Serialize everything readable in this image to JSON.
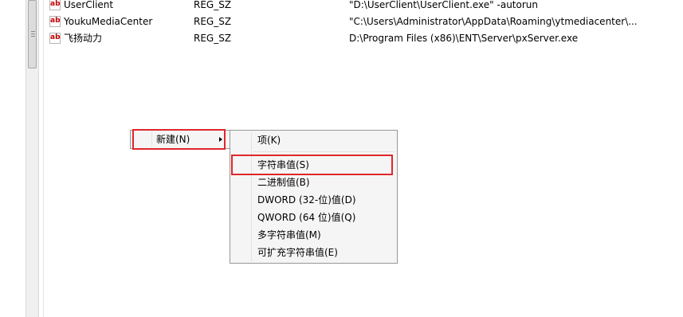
{
  "registry_values": [
    {
      "name": "UserClient",
      "type": "REG_SZ",
      "data": "\"D:\\UserClient\\UserClient.exe\" -autorun"
    },
    {
      "name": "YoukuMediaCenter",
      "type": "REG_SZ",
      "data": "\"C:\\Users\\Administrator\\AppData\\Roaming\\ytmediacenter\\..."
    },
    {
      "name": "飞扬动力",
      "type": "REG_SZ",
      "data": "D:\\Program Files (x86)\\ENT\\Server\\pxServer.exe"
    }
  ],
  "value_icon_label": "ab",
  "context_menu": {
    "new_label": "新建(N)"
  },
  "new_submenu": {
    "items": [
      {
        "label": "项(K)"
      },
      {
        "label": "字符串值(S)"
      },
      {
        "label": "二进制值(B)"
      },
      {
        "label": "DWORD (32-位)值(D)"
      },
      {
        "label": "QWORD (64 位)值(Q)"
      },
      {
        "label": "多字符串值(M)"
      },
      {
        "label": "可扩充字符串值(E)"
      }
    ]
  },
  "colors": {
    "highlight_border": "#e0262b",
    "menu_background": "#f5f5f5",
    "icon_text": "#c00000"
  }
}
